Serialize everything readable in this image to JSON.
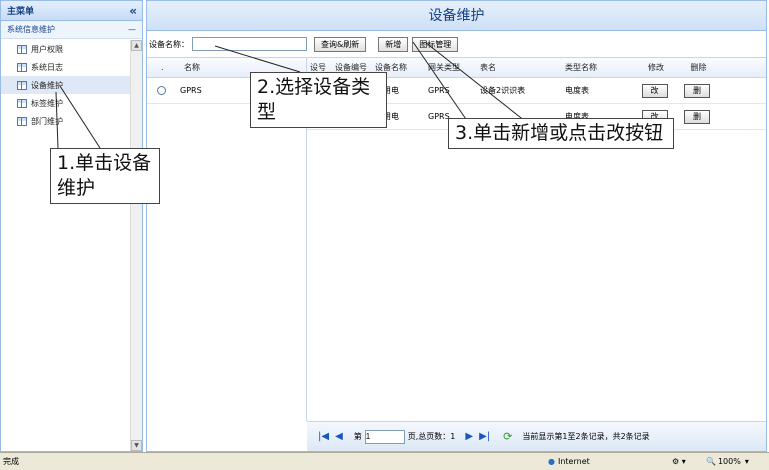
{
  "sidebar": {
    "header": "主菜单",
    "collapse_icon": "«",
    "group_title": "系统信息维护",
    "group_toggle": "—",
    "items": [
      {
        "label": "用户权限"
      },
      {
        "label": "系统日志"
      },
      {
        "label": "设备维护"
      },
      {
        "label": "标签维护"
      },
      {
        "label": "部门维护"
      }
    ]
  },
  "main": {
    "title": "设备维护",
    "toolbar": {
      "device_name_label": "设备名称：",
      "device_name_value": "",
      "query_button": "查询&刷新",
      "add_button": "新增",
      "icon_manage_button": "图标管理"
    },
    "left_grid": {
      "headers": [
        ".",
        "名称"
      ],
      "rows": [
        {
          "name": "GPRS"
        }
      ]
    },
    "right_grid": {
      "headers": [
        "设号",
        "设备编号",
        "设备名称",
        "网关类型",
        "表名",
        "类型名称",
        "修改",
        "删除"
      ],
      "rows": [
        {
          "col1": "",
          "col2": "",
          "col3": "家用电",
          "col4": "GPRS",
          "col5": "设备2识识表",
          "col6": "电度表",
          "edit": "改",
          "del": "删"
        },
        {
          "col1": "",
          "col2": "",
          "col3": "家用电",
          "col4": "GPRS",
          "col5": "",
          "col6": "电度表",
          "edit": "改",
          "del": "删"
        }
      ]
    },
    "pager": {
      "page_prefix": "第",
      "page_value": "1",
      "total_pages": "页,总页数：1",
      "summary": "当前显示第1至2条记录，共2条记录"
    }
  },
  "status_bar": {
    "left": "完成",
    "zone": "Internet",
    "zoom": "100%"
  },
  "annotations": [
    {
      "text": "1.单击设备维护"
    },
    {
      "text": "2.选择设备类型"
    },
    {
      "text": "3.单击新增或点击改按钮"
    }
  ],
  "colors": {
    "accent": "#15428b",
    "border": "#99bbe8",
    "header_bg": "#cfe0f5"
  }
}
